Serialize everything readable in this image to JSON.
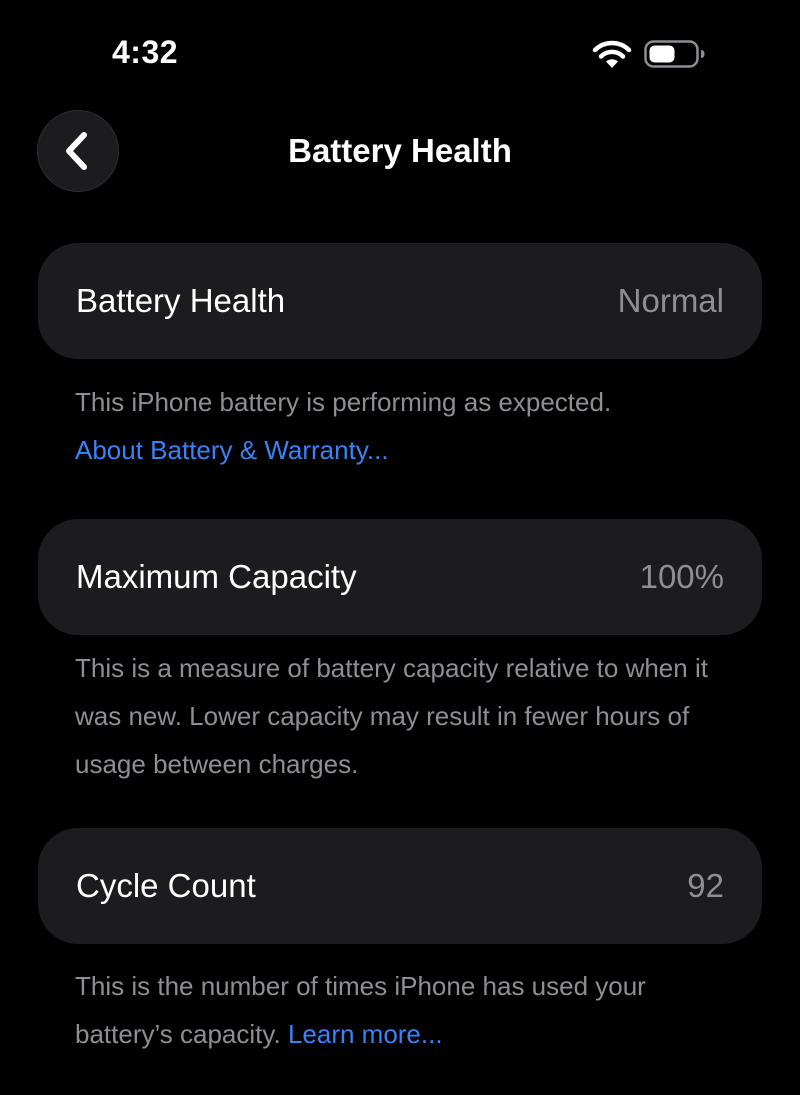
{
  "status_bar": {
    "time": "4:32",
    "icons": [
      "wifi-icon",
      "battery-icon"
    ]
  },
  "nav": {
    "back_icon": "chevron-left-icon",
    "title": "Battery Health"
  },
  "sections": [
    {
      "label": "Battery Health",
      "value": "Normal",
      "note": "This iPhone battery is performing as expected.",
      "link": "About Battery & Warranty..."
    },
    {
      "label": "Maximum Capacity",
      "value": "100%",
      "note": "This is a measure of battery capacity relative to when it was new. Lower capacity may result in fewer hours of usage between charges."
    },
    {
      "label": "Cycle Count",
      "value": "92",
      "note": "This is the number of times iPhone has used your battery’s capacity.",
      "link": "Learn more..."
    }
  ],
  "colors": {
    "background": "#000000",
    "card": "#1c1c1e",
    "secondary_text": "#8e8e93",
    "link": "#3a82f7"
  }
}
